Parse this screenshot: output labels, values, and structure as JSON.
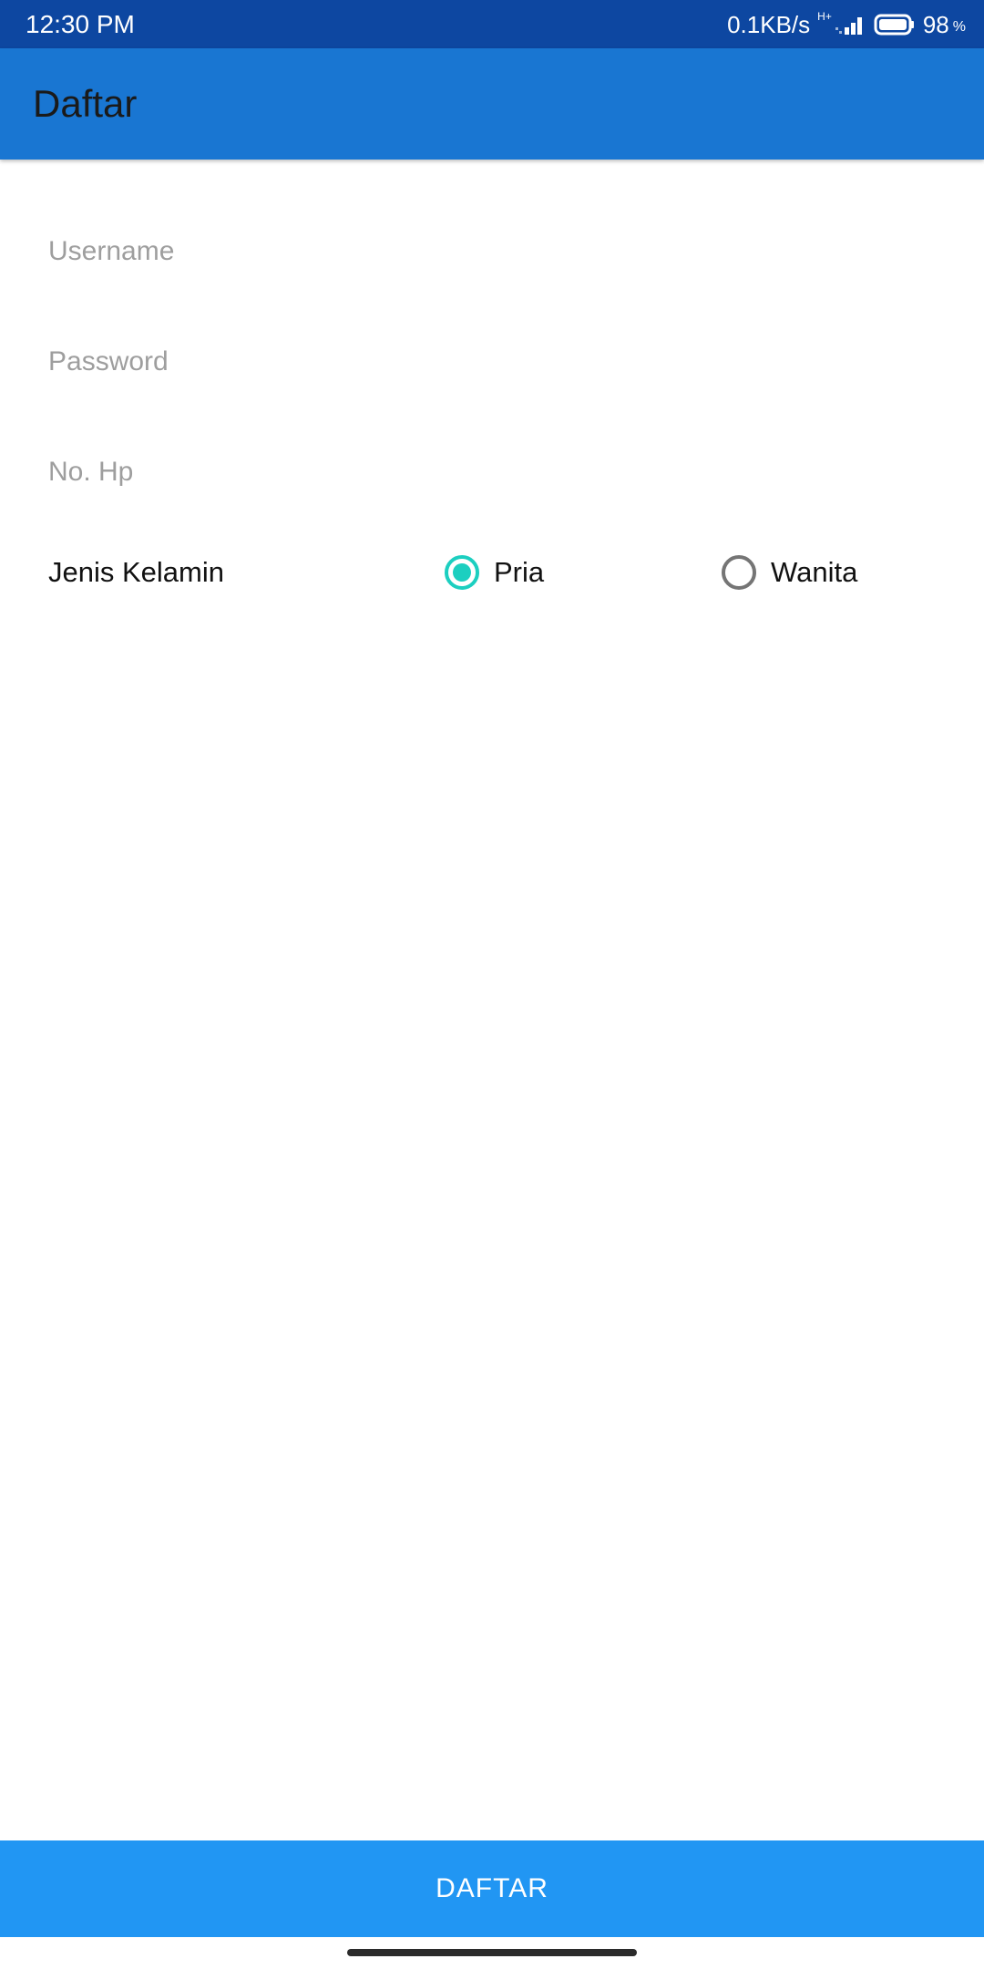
{
  "status_bar": {
    "time": "12:30 PM",
    "net_speed": "0.1KB/s",
    "net_type": "H+",
    "battery_level": "98",
    "battery_unit": "%",
    "icons": [
      "signal-icon",
      "battery-icon"
    ]
  },
  "app_bar": {
    "title": "Daftar",
    "background_color": "#1976d2"
  },
  "form": {
    "username": {
      "value": "",
      "placeholder": "Username"
    },
    "password": {
      "value": "",
      "placeholder": "Password"
    },
    "phone": {
      "value": "",
      "placeholder": "No. Hp"
    },
    "gender": {
      "label": "Jenis Kelamin",
      "options": [
        {
          "label": "Pria",
          "selected": true
        },
        {
          "label": "Wanita",
          "selected": false
        }
      ]
    }
  },
  "submit_button": {
    "label": "DAFTAR",
    "background_color": "#2196f3"
  },
  "colors": {
    "status_bar": "#0d47a1",
    "radio_accent": "#1ccfc0"
  }
}
